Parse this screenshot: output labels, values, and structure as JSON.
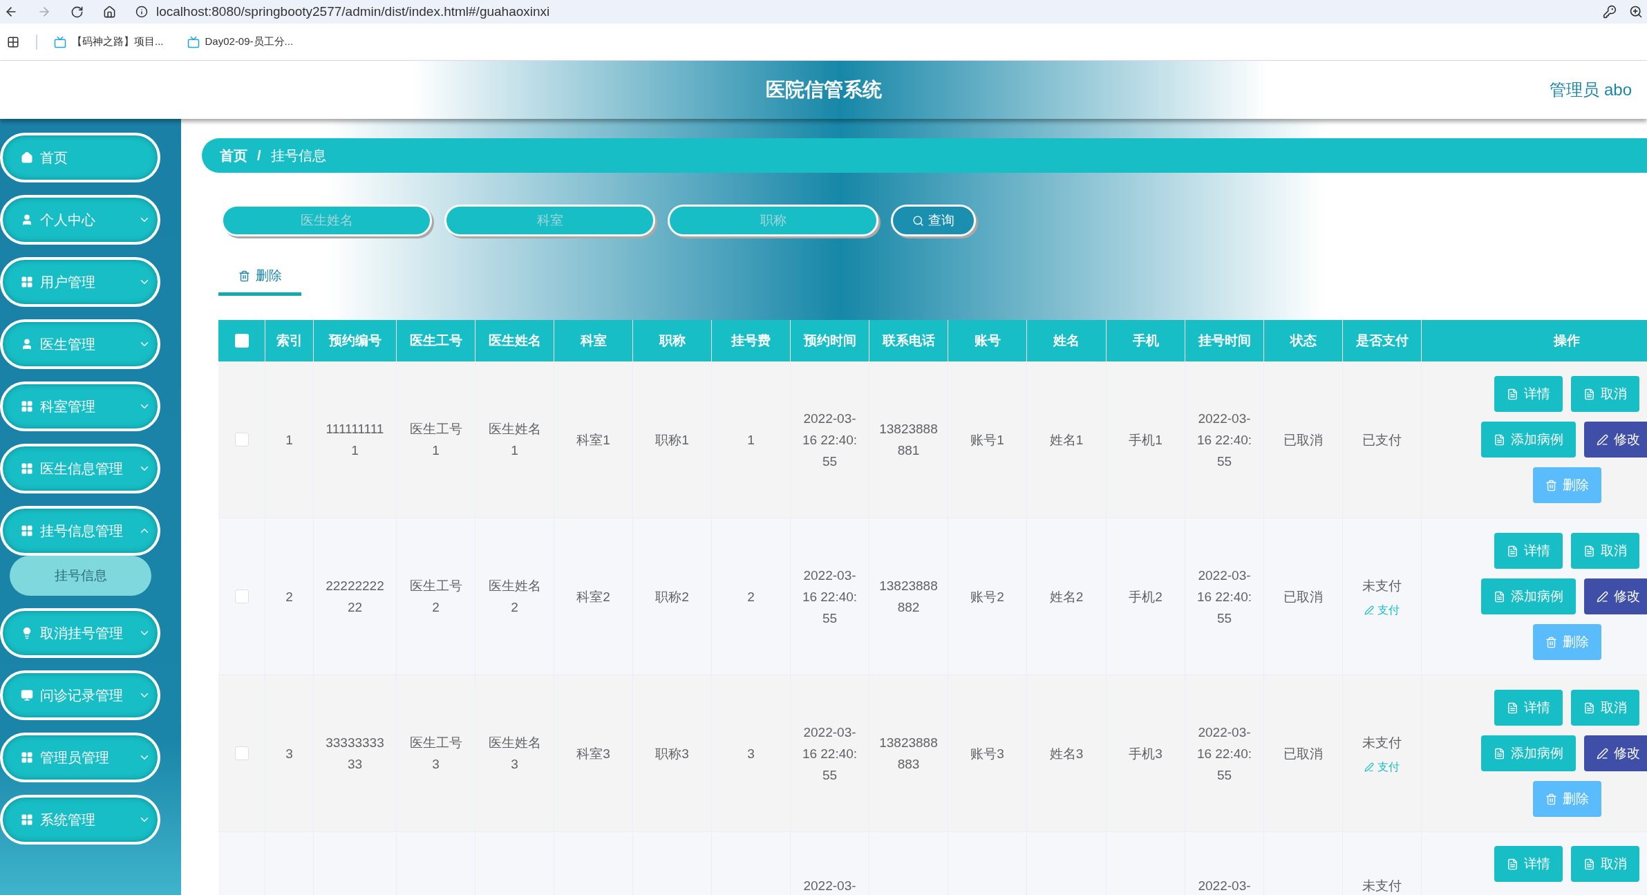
{
  "browser": {
    "url": "localhost:8080/springbooty2577/admin/dist/index.html#/guahaoxinxi",
    "bookmarks": [
      "【码神之路】项目...",
      "Day02-09-员工分..."
    ]
  },
  "header": {
    "title": "医院信管系统",
    "user": "管理员 abo"
  },
  "sidebar": {
    "items": [
      {
        "label": "首页",
        "kind": "home"
      },
      {
        "label": "个人中心",
        "kind": "user",
        "expanded": false
      },
      {
        "label": "用户管理",
        "kind": "grid",
        "expanded": false
      },
      {
        "label": "医生管理",
        "kind": "user",
        "expanded": false
      },
      {
        "label": "科室管理",
        "kind": "grid",
        "expanded": false
      },
      {
        "label": "医生信息管理",
        "kind": "grid",
        "expanded": false
      },
      {
        "label": "挂号信息管理",
        "kind": "grid",
        "expanded": true,
        "children": [
          {
            "label": "挂号信息",
            "selected": true
          }
        ]
      },
      {
        "label": "取消挂号管理",
        "kind": "bulb",
        "expanded": false
      },
      {
        "label": "问诊记录管理",
        "kind": "monitor",
        "expanded": false
      },
      {
        "label": "管理员管理",
        "kind": "grid",
        "expanded": false
      },
      {
        "label": "系统管理",
        "kind": "grid",
        "expanded": false
      }
    ]
  },
  "breadcrumb": {
    "items": [
      "首页",
      "挂号信息"
    ],
    "separator": "/"
  },
  "search": {
    "fields": [
      {
        "placeholder": "医生姓名"
      },
      {
        "placeholder": "科室"
      },
      {
        "placeholder": "职称"
      }
    ],
    "button": "查询"
  },
  "toolbar": {
    "delete": "删除"
  },
  "table": {
    "select_all_checked": false,
    "columns": [
      "索引",
      "预约编号",
      "医生工号",
      "医生姓名",
      "科室",
      "职称",
      "挂号费",
      "预约时间",
      "联系电话",
      "账号",
      "姓名",
      "手机",
      "挂号时间",
      "状态",
      "是否支付"
    ],
    "actions_label": "操作",
    "rows": [
      {
        "kind": "full",
        "checked": false,
        "cells": [
          "1",
          "1111111111",
          "医生工号1",
          "医生姓名1",
          "科室1",
          "职称1",
          "1",
          "2022-03-16 22:40:55",
          "13823888881",
          "账号1",
          "姓名1",
          "手机1",
          "2022-03-16 22:40:55",
          "已取消",
          "已支付"
        ],
        "actions": [
          [
            {
              "label": "详情",
              "kind": "plain"
            },
            {
              "label": "取消",
              "kind": "plain"
            }
          ],
          [
            {
              "label": "添加病例",
              "kind": "plain"
            },
            {
              "label": "修改",
              "kind": "edit"
            }
          ],
          [
            {
              "label": "删除",
              "kind": "delete"
            }
          ]
        ]
      },
      {
        "kind": "full",
        "checked": false,
        "cells": [
          "2",
          "2222222222",
          "医生工号2",
          "医生姓名2",
          "科室2",
          "职称2",
          "2",
          "2022-03-16 22:40:55",
          "13823888882",
          "账号2",
          "姓名2",
          "手机2",
          "2022-03-16 22:40:55",
          "已取消",
          "未支付"
        ],
        "pay_link": "支付",
        "actions": [
          [
            {
              "label": "详情",
              "kind": "plain"
            },
            {
              "label": "取消",
              "kind": "plain"
            }
          ],
          [
            {
              "label": "添加病例",
              "kind": "plain"
            },
            {
              "label": "修改",
              "kind": "edit"
            }
          ],
          [
            {
              "label": "删除",
              "kind": "delete"
            }
          ]
        ]
      },
      {
        "kind": "full",
        "checked": false,
        "cells": [
          "3",
          "3333333333",
          "医生工号3",
          "医生姓名3",
          "科室3",
          "职称3",
          "3",
          "2022-03-16 22:40:55",
          "13823888883",
          "账号3",
          "姓名3",
          "手机3",
          "2022-03-16 22:40:55",
          "已取消",
          "未支付"
        ],
        "pay_link": "支付",
        "actions": [
          [
            {
              "label": "详情",
              "kind": "plain"
            },
            {
              "label": "取消",
              "kind": "plain"
            }
          ],
          [
            {
              "label": "添加病例",
              "kind": "plain"
            },
            {
              "label": "修改",
              "kind": "edit"
            }
          ],
          [
            {
              "label": "删除",
              "kind": "delete"
            }
          ]
        ]
      },
      {
        "kind": "partial",
        "cells": [
          null,
          null,
          null,
          null,
          null,
          null,
          null,
          "2022-03-",
          null,
          null,
          null,
          null,
          "2022-03-",
          null,
          "未支付"
        ],
        "actions": [
          [
            {
              "label": "详情",
              "kind": "plain"
            },
            {
              "label": "取消",
              "kind": "plain"
            }
          ]
        ]
      }
    ]
  }
}
